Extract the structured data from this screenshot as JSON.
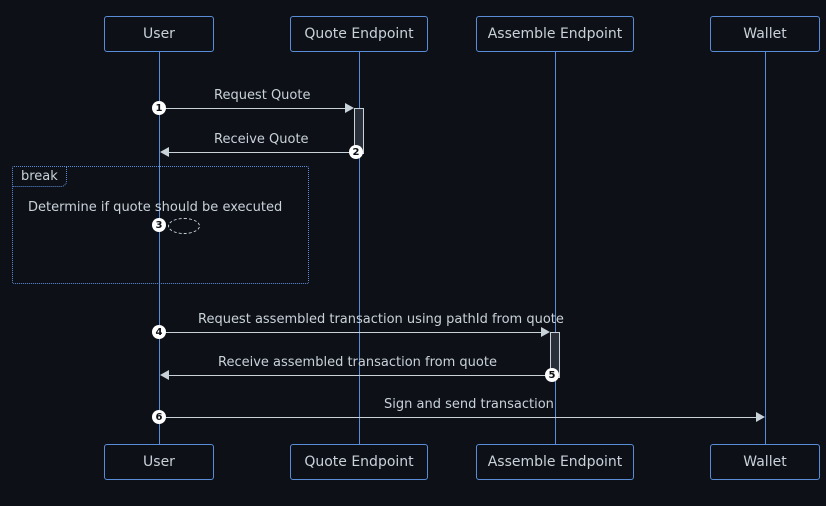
{
  "actors": {
    "user": "User",
    "quote": "Quote Endpoint",
    "assemble": "Assemble Endpoint",
    "wallet": "Wallet"
  },
  "messages": {
    "m1": "Request Quote",
    "m2": "Receive Quote",
    "m3": "Request assembled transaction using pathId from quote",
    "m4": "Receive assembled transaction from quote",
    "m5": "Sign and send transaction"
  },
  "break": {
    "label": "break",
    "text": "Determine if quote should be executed"
  },
  "seq": {
    "n1": "1",
    "n2": "2",
    "n3": "3",
    "n4": "4",
    "n5": "5",
    "n6": "6"
  }
}
